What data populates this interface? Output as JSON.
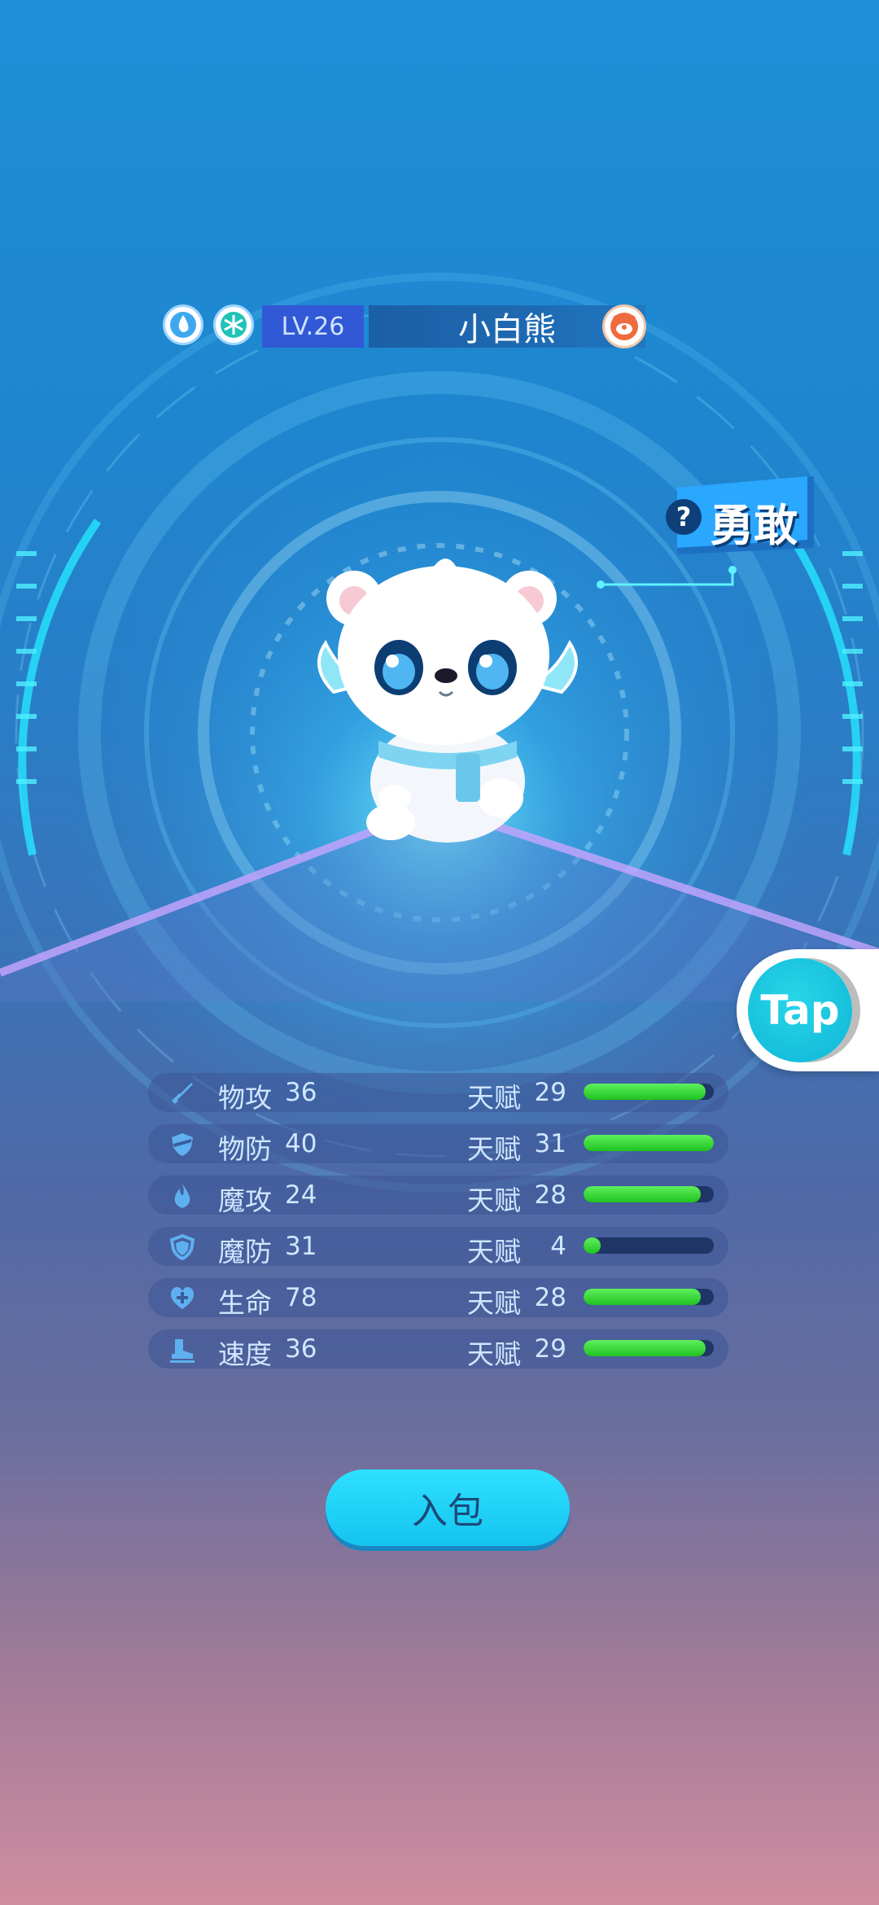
{
  "pet": {
    "level_label": "LV.26",
    "name": "小白熊",
    "trait_label": "勇敢",
    "trait_info_glyph": "?",
    "element_icons": [
      "water-drop-icon",
      "snowflake-icon"
    ],
    "badge_icon": "bear-badge-icon"
  },
  "stats_header": {
    "talent_label": "天赋"
  },
  "stats": [
    {
      "name": "物攻",
      "value": "36",
      "talent": "29",
      "icon": "sword-icon",
      "fill": 0.94
    },
    {
      "name": "物防",
      "value": "40",
      "talent": "31",
      "icon": "shield-icon",
      "fill": 1.0
    },
    {
      "name": "魔攻",
      "value": "24",
      "talent": "28",
      "icon": "flame-icon",
      "fill": 0.9
    },
    {
      "name": "魔防",
      "value": "31",
      "talent": "4",
      "icon": "magic-shield-icon",
      "fill": 0.13
    },
    {
      "name": "生命",
      "value": "78",
      "talent": "28",
      "icon": "heart-icon",
      "fill": 0.9
    },
    {
      "name": "速度",
      "value": "36",
      "talent": "29",
      "icon": "boot-icon",
      "fill": 0.94
    }
  ],
  "actions": {
    "bag_button": "入包",
    "tap_button": "Tap"
  },
  "colors": {
    "accent_cyan": "#22d8ff",
    "bar_green": "#2ad42a",
    "level_bg": "#3159d6"
  }
}
